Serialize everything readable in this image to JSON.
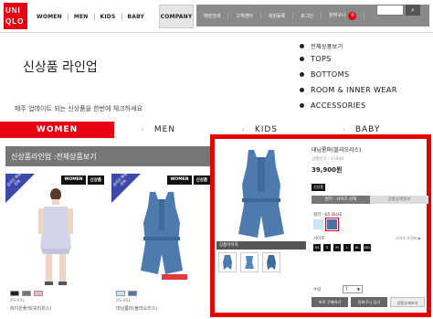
{
  "brand": {
    "logo_line1": "UNI",
    "logo_line2": "QLO",
    "color": "#e60012"
  },
  "nav": {
    "items": [
      "WOMEN",
      "MEN",
      "KIDS",
      "BABY"
    ],
    "company": "COMPANY"
  },
  "utility": {
    "items": [
      "매장안내",
      "고객센터",
      "회원등록",
      "로그인",
      "장바구니"
    ],
    "cart_count": "0"
  },
  "page": {
    "title": "신상품 라인업",
    "subtitle": "매주 업데이트 되는 신상품을 한번에 체크하세요"
  },
  "side_menu": {
    "header": "전체상품보기",
    "items": [
      "TOPS",
      "BOTTOMS",
      "ROOM & INNER WEAR",
      "ACCESSORIES"
    ]
  },
  "category_tabs": [
    "WOMEN",
    "MEN",
    "KIDS",
    "BABY"
  ],
  "section": {
    "title": "신상품라인업 :전체상품보기"
  },
  "products": [
    {
      "ribbon": "온라인\n특별판매",
      "badges": [
        "WOMEN",
        "신상품"
      ],
      "size": "XS-XXL",
      "name": "레이온플레(보리프스)",
      "swatches": [
        "#222222",
        "#777777",
        "#e7b6c7"
      ]
    },
    {
      "ribbon": "온라인\n특별판매",
      "badges": [
        "WOMEN",
        "신상품"
      ],
      "size": "XS-XXL",
      "name": "데님롬퍼(불리오리스)",
      "swatches": [
        "#bfe3f5",
        "#5677a8"
      ]
    }
  ],
  "detail": {
    "name": "데님롬퍼(블리오리스)",
    "code": "상품번호 : 43944",
    "price": "39,900원",
    "new_tag": "신상품",
    "tabs": [
      "컬러 · 사이즈 선택",
      "상품상세정보"
    ],
    "color_label": "컬러 : 65 BLUE",
    "colors": [
      "#c9e4f3",
      "#4d6fa8"
    ],
    "size_label": "사이즈",
    "size_guide": "사이즈 조견표 ▶",
    "sizes": [
      "XS",
      "S",
      "M",
      "L",
      "XL",
      "XXL"
    ],
    "qty_label": "수량",
    "qty_value": "1",
    "thumb_label": "상품이미지",
    "actions": [
      "바로 구매하기",
      "장바구니 담기",
      "상품상세보기"
    ],
    "accent": "#e60000"
  }
}
